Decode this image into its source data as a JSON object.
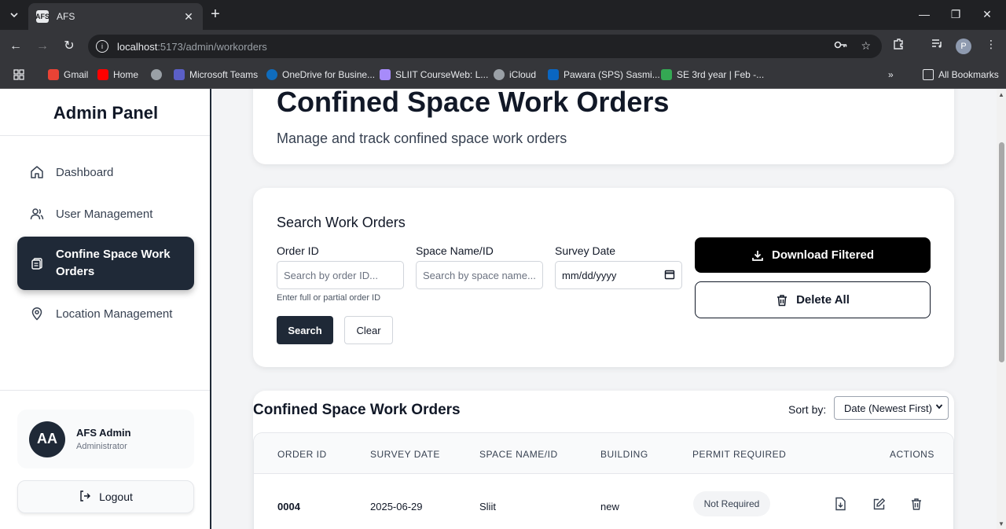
{
  "browser": {
    "tab_title": "AFS",
    "tab_favicon": "AFS",
    "url_host": "localhost",
    "url_path": ":5173/admin/workorders",
    "profile_initial": "P",
    "bookmarks": [
      {
        "label": "Gmail",
        "color": "#ea4335"
      },
      {
        "label": "Home",
        "color": "#ff0000"
      },
      {
        "label": "",
        "color": "#9aa0a6"
      },
      {
        "label": "Microsoft Teams",
        "color": "#5b5fc7"
      },
      {
        "label": "OneDrive for Busine...",
        "color": "#0f6cbd"
      },
      {
        "label": "SLIIT CourseWeb: L...",
        "color": "#a78bfa"
      },
      {
        "label": "iCloud",
        "color": "#9aa0a6"
      },
      {
        "label": "Pawara (SPS) Sasmi...",
        "color": "#0a66c2"
      },
      {
        "label": "SE 3rd year | Feb -...",
        "color": "#34a853"
      }
    ],
    "all_bookmarks_label": "All Bookmarks"
  },
  "sidebar": {
    "brand": "Admin Panel",
    "items": [
      {
        "label": "Dashboard",
        "icon": "home-icon"
      },
      {
        "label": "User Management",
        "icon": "users-icon"
      },
      {
        "label": "Confine Space Work Orders",
        "icon": "clipboard-icon"
      },
      {
        "label": "Location Management",
        "icon": "map-pin-icon"
      }
    ],
    "user": {
      "initials": "AA",
      "name": "AFS Admin",
      "role": "Administrator"
    },
    "logout_label": "Logout"
  },
  "hero": {
    "title": "Confined Space Work Orders",
    "subtitle": "Manage and track confined space work orders"
  },
  "search": {
    "title": "Search Work Orders",
    "order_id_label": "Order ID",
    "order_id_placeholder": "Search by order ID...",
    "order_id_hint": "Enter full or partial order ID",
    "space_label": "Space Name/ID",
    "space_placeholder": "Search by space name...",
    "date_label": "Survey Date",
    "date_placeholder": "mm/dd/yyyy",
    "search_button": "Search",
    "clear_button": "Clear",
    "download_button": "Download Filtered",
    "delete_button": "Delete All"
  },
  "list": {
    "title": "Confined Space Work Orders",
    "sort_label": "Sort by:",
    "sort_value": "Date (Newest First)",
    "columns": [
      "ORDER ID",
      "SURVEY DATE",
      "SPACE NAME/ID",
      "BUILDING",
      "PERMIT REQUIRED",
      "ACTIONS"
    ],
    "rows": [
      {
        "order_id": "0004",
        "survey_date": "2025-06-29",
        "space": "Sliit",
        "building": "new",
        "permit": "Not Required"
      }
    ]
  }
}
